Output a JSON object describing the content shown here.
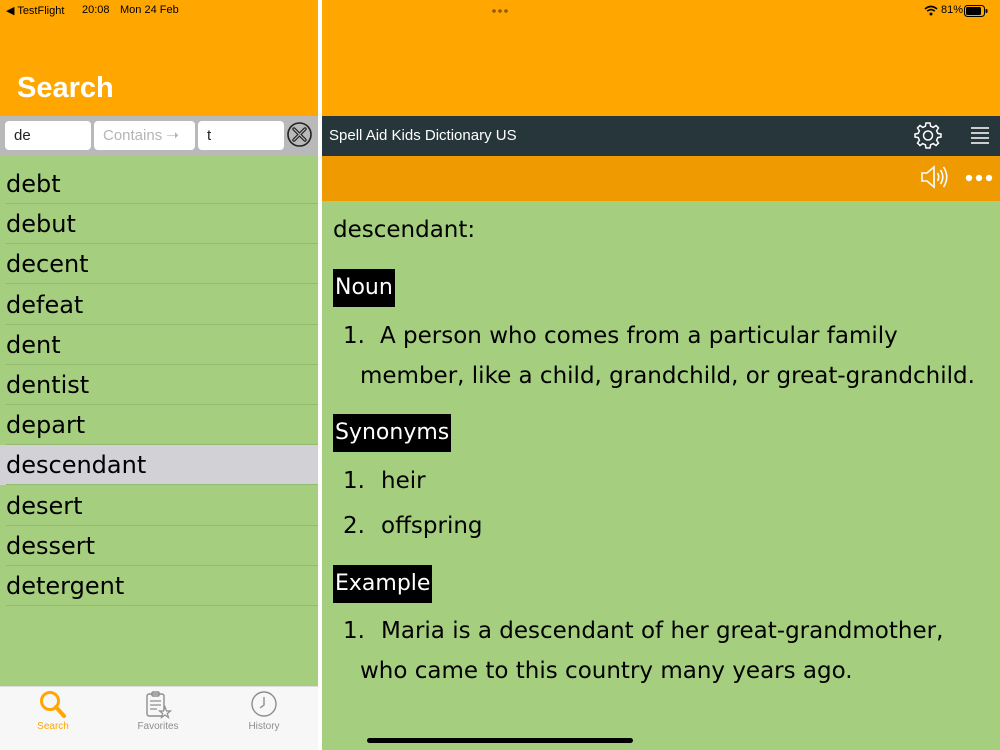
{
  "status_bar": {
    "back_label": "◀ TestFlight",
    "time": "20:08",
    "date": "Mon 24 Feb",
    "battery": "81%"
  },
  "search_panel": {
    "title": "Search",
    "prefix_value": "de",
    "mode_label": "Contains ➝",
    "suffix_value": "t",
    "words": [
      "debt",
      "debut",
      "decent",
      "defeat",
      "dent",
      "dentist",
      "depart",
      "descendant",
      "desert",
      "dessert",
      "detergent"
    ],
    "selected_word": "descendant"
  },
  "tabs": {
    "search": "Search",
    "favorites": "Favorites",
    "history": "History"
  },
  "app": {
    "title": "Spell Aid Kids Dictionary US"
  },
  "entry": {
    "headword": "descendant:",
    "noun_label": "Noun",
    "noun_num": "1.",
    "noun_def_line1": "A person who comes from a particular family",
    "noun_def_line2": "member, like a child, grandchild, or great-grandchild.",
    "synonyms_label": "Synonyms",
    "synonym1_num": "1.",
    "synonym1": "heir",
    "synonym2_num": "2.",
    "synonym2": "offspring",
    "example_label": "Example",
    "example_num": "1.",
    "example_line1": "Maria is a descendant of her great-grandmother,",
    "example_line2": "who came to this country many years ago."
  },
  "colors": {
    "header_orange": "#ffa700",
    "action_orange": "#ef9a00",
    "content_green": "#a5cf7f",
    "nav_dark": "#26363a",
    "selected_gray": "#d2d2d6"
  },
  "icons": {
    "clear": "clear-circle-x-icon",
    "settings": "gear-icon",
    "menu": "hamburger-menu-icon",
    "speaker": "speaker-icon",
    "more": "more-dots-icon",
    "tab_search": "magnifier-icon",
    "tab_favorites": "clipboard-star-icon",
    "tab_history": "clock-icon"
  }
}
